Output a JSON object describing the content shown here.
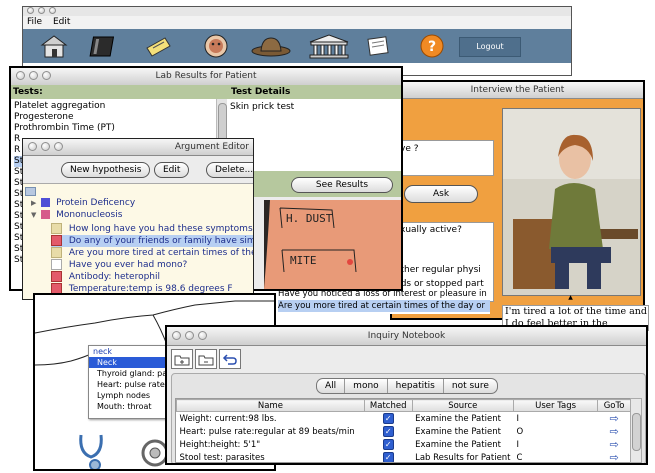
{
  "main_window": {
    "menu": {
      "file": "File",
      "edit": "Edit"
    },
    "toolbar": {
      "logout_label": "Logout"
    },
    "colors": {
      "toolbar_bg": "#5f7f9c",
      "logout_bg": "#4f6f8c"
    }
  },
  "lab_results": {
    "title": "Lab Results for Patient",
    "tests_header": "Tests:",
    "details_header": "Test Details",
    "tests": [
      "Platelet aggregation",
      "Progesterone",
      "Prothrombin Time (PT)",
      "R",
      "R",
      "St",
      "St",
      "St",
      "St",
      "St",
      "St",
      "St",
      "St",
      "St",
      "St"
    ],
    "detail_text": "Skin prick  test",
    "see_results": "See Results",
    "skin_labels": [
      "H. DUST",
      "MITE"
    ],
    "colors": {
      "header_bg": "#b6c89e"
    }
  },
  "interview": {
    "title": "Interview the Patient",
    "question_fragment_1": "ve ?",
    "ask_label": "Ask",
    "question_fragment_2": "xually active?",
    "list_fragments": [
      "other regular physi",
      "nds or stopped part"
    ],
    "list_items": [
      "Have you noticed a loss of interest or pleasure in",
      "Are you more tired at certain times of the day or"
    ],
    "response_text": "I'm tired a lot of the time and I do feel better in the morning",
    "colors": {
      "frame_bg": "#f0a040"
    }
  },
  "argument_editor": {
    "title": "Argument Editor",
    "buttons": {
      "new_hypothesis": "New hypothesis",
      "edit": "Edit",
      "delete": "Delete..."
    },
    "tree": [
      {
        "label": "Protein Deficency",
        "color": "#4f4fd6",
        "expanded": false
      },
      {
        "label": "Mononucleosis",
        "color": "#d65b8a",
        "expanded": true
      }
    ],
    "items": [
      {
        "label": "How long have you had these symptoms?",
        "color": "#e8dca8"
      },
      {
        "label": "Do any of your friends or family have similar sy",
        "color": "#e35a6a",
        "selected": true
      },
      {
        "label": "Are you more tired at certain times of the day o",
        "color": "#e8dca8"
      },
      {
        "label": "Have you ever had mono?",
        "color": "#ffffff"
      },
      {
        "label": "Antibody: heterophil",
        "color": "#e35a6a"
      },
      {
        "label": "Temperature:temp is 98.6 degrees F",
        "color": "#e35a6a"
      }
    ]
  },
  "body_map": {
    "popup_header": "neck",
    "popup_items": [
      "Neck",
      "Thyroid gland: pa",
      "Heart: pulse rate",
      "Lymph nodes",
      "Mouth: throat"
    ]
  },
  "notebook": {
    "title": "Inquiry Notebook",
    "filters": [
      "All",
      "mono",
      "hepatitis",
      "not sure"
    ],
    "columns": [
      "Name",
      "Matched",
      "Source",
      "User Tags",
      "GoTo"
    ],
    "rows": [
      {
        "name": "Weight: current:98 lbs.",
        "source": "Examine the Patient",
        "tag": "I"
      },
      {
        "name": "Heart: pulse rate:regular at 89 beats/min",
        "source": "Examine the Patient",
        "tag": "O"
      },
      {
        "name": "Height:height: 5'1\"",
        "source": "Examine the Patient",
        "tag": "I"
      },
      {
        "name": "Stool test: parasites",
        "source": "Lab Results for Patient",
        "tag": "C"
      }
    ]
  }
}
